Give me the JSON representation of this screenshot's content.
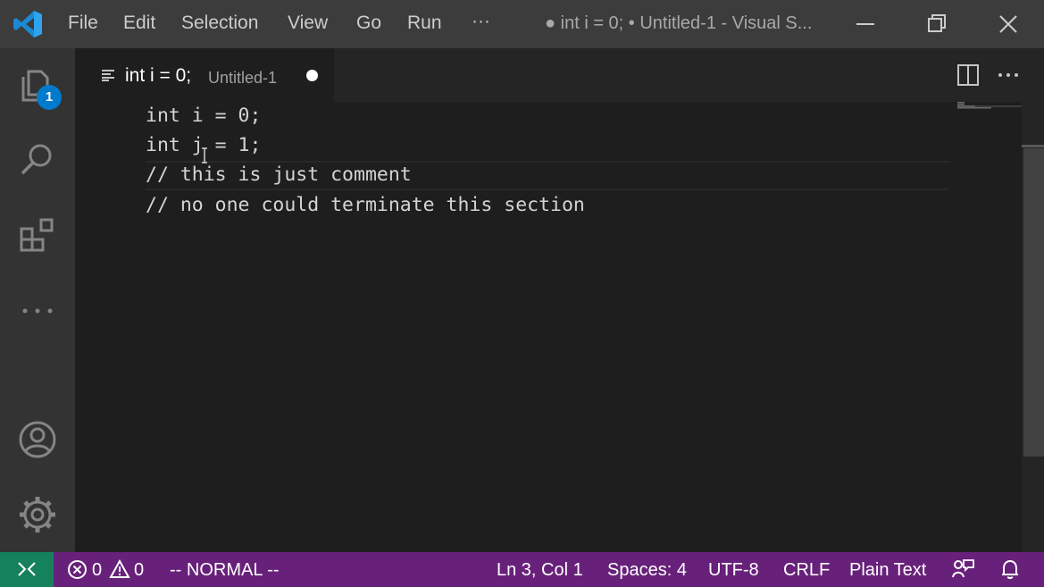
{
  "titlebar": {
    "menu": [
      "File",
      "Edit",
      "Selection",
      "View",
      "Go",
      "Run",
      "···"
    ],
    "window_title": "● int i = 0; • Untitled-1 - Visual S...",
    "logo_icon": "vscode-logo-icon"
  },
  "activitybar": {
    "explorer_badge": "1",
    "accent": "#007acc"
  },
  "tab": {
    "title": "int i = 0;",
    "description": "Untitled-1"
  },
  "editor": {
    "lines": [
      "int i = 0;",
      "int j = 1;",
      "// this is just comment",
      "// no one could terminate this section"
    ]
  },
  "statusbar": {
    "errors": "0",
    "warnings": "0",
    "mode": "-- NORMAL --",
    "position": "Ln 3, Col 1",
    "spaces": "Spaces: 4",
    "encoding": "UTF-8",
    "eol": "CRLF",
    "language": "Plain Text",
    "background": "#68217a",
    "remote_color": "#16825d"
  }
}
